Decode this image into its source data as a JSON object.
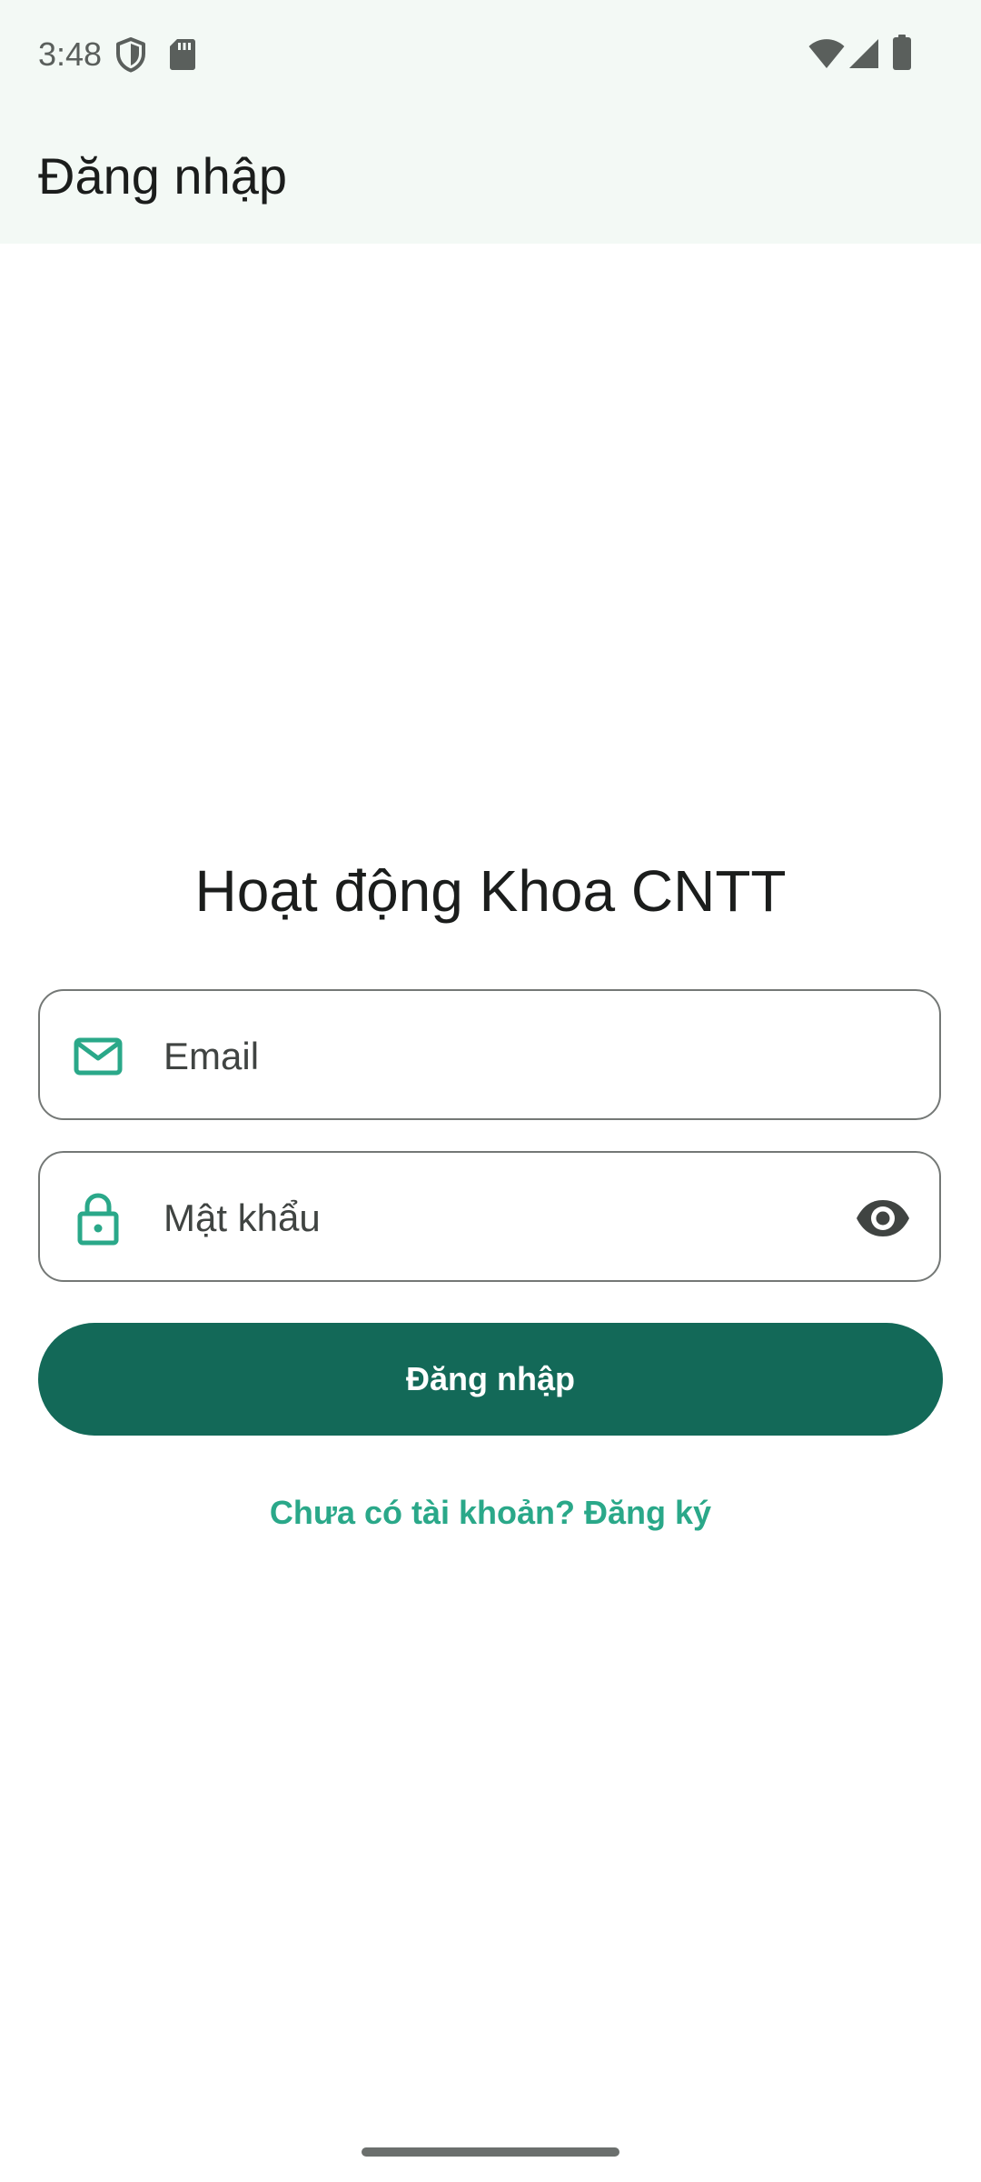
{
  "status_bar": {
    "time": "3:48",
    "icons": [
      "shield-icon",
      "sd-card-icon",
      "wifi-icon",
      "cellular-signal-icon",
      "battery-icon"
    ]
  },
  "app_bar": {
    "title": "Đăng nhập"
  },
  "main": {
    "headline": "Hoạt động Khoa CNTT",
    "email_field": {
      "placeholder": "Email",
      "value": "",
      "leading_icon": "mail-icon"
    },
    "password_field": {
      "placeholder": "Mật khẩu",
      "value": "",
      "leading_icon": "lock-icon",
      "trailing_icon": "visibility-icon"
    },
    "login_button_label": "Đăng nhập",
    "register_link": "Chưa có tài khoản? Đăng ký"
  },
  "colors": {
    "primary": "#136958",
    "accent": "#2aa889",
    "surface": "#f3f9f5",
    "outline": "#747876"
  }
}
